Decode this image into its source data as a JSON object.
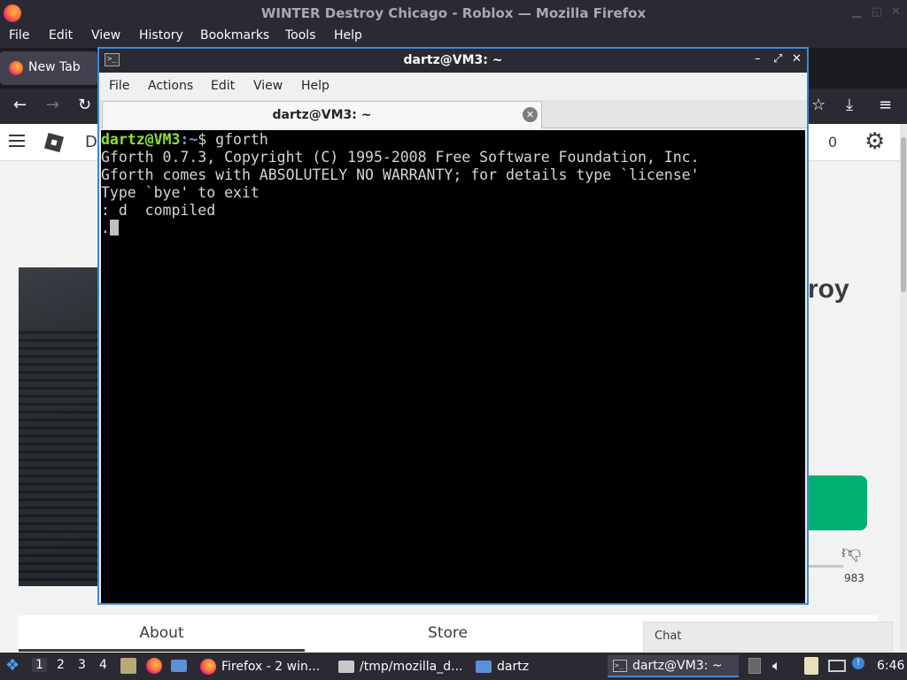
{
  "firefox": {
    "window_title": "WINTER Destroy Chicago - Roblox — Mozilla Firefox",
    "menu": [
      "File",
      "Edit",
      "View",
      "History",
      "Bookmarks",
      "Tools",
      "Help"
    ],
    "tab_label": "New Tab"
  },
  "roblox_page": {
    "topbar_letter": "D",
    "robux_count": "0",
    "title_fragment": "roy",
    "downvotes": "983",
    "tabs": [
      "About",
      "Store"
    ],
    "chat_label": "Chat"
  },
  "terminal": {
    "window_title": "dartz@VM3: ~",
    "menu": [
      "File",
      "Actions",
      "Edit",
      "View",
      "Help"
    ],
    "tab_label": "dartz@VM3: ~",
    "prompt_user": "dartz@VM3",
    "prompt_path": ":~",
    "prompt_symbol": "$ ",
    "command": "gforth",
    "output": [
      "Gforth 0.7.3, Copyright (C) 1995-2008 Free Software Foundation, Inc.",
      "Gforth comes with ABSOLUTELY NO WARRANTY; for details type `license'",
      "Type `bye' to exit",
      ": d  compiled"
    ],
    "current_input": "."
  },
  "taskbar": {
    "workspaces": [
      "1",
      "2",
      "3",
      "4"
    ],
    "tasks": [
      "Firefox - 2 win...",
      "/tmp/mozilla_d...",
      "dartz",
      "dartz@VM3: ~"
    ],
    "clock": "6:46"
  },
  "colors": {
    "accent": "#3d88d8",
    "prompt_user": "#8ae234",
    "prompt_path": "#729fcf",
    "play_button": "#00b06f"
  }
}
